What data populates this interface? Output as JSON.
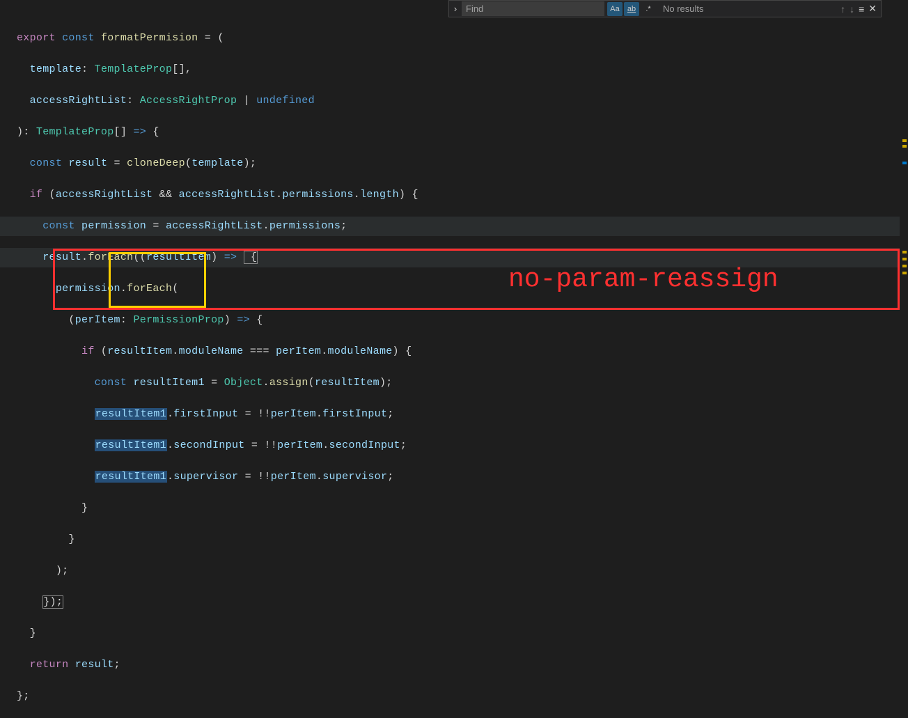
{
  "find": {
    "placeholder": "Find",
    "results": "No results",
    "toggles": {
      "aa": "Aa",
      "ab": "ab",
      "regex": ".*"
    }
  },
  "annotation": "no-param-reassign",
  "code": {
    "l1": {
      "a": "export",
      "b": "const",
      "c": "formatPermision",
      "d": " = ("
    },
    "l2": {
      "a": "template",
      "b": ": ",
      "c": "TemplateProp",
      "d": "[],"
    },
    "l3": {
      "a": "accessRightList",
      "b": ": ",
      "c": "AccessRightProp",
      "d": " | ",
      "e": "undefined"
    },
    "l4": {
      "a": "): ",
      "b": "TemplateProp",
      "c": "[] ",
      "d": "=>",
      "e": " {"
    },
    "l5": {
      "a": "const",
      "b": "result",
      "c": " = ",
      "d": "cloneDeep",
      "e": "(",
      "f": "template",
      "g": ");"
    },
    "l6": {
      "a": "if",
      "b": " (",
      "c": "accessRightList",
      "d": " && ",
      "e": "accessRightList",
      "f": ".",
      "g": "permissions",
      "h": ".",
      "i": "length",
      "j": ") {"
    },
    "l7": {
      "a": "const",
      "b": "permission",
      "c": " = ",
      "d": "accessRightList",
      "e": ".",
      "f": "permissions",
      "g": ";"
    },
    "l8": {
      "a": "result",
      "b": ".",
      "c": "forEach",
      "d": "((",
      "e": "resultItem",
      "f": ") ",
      "g": "=>",
      "h": " {"
    },
    "l9": {
      "a": "permission",
      "b": ".",
      "c": "forEach",
      "d": "("
    },
    "l10": {
      "a": "(",
      "b": "perItem",
      "c": ": ",
      "d": "PermissionProp",
      "e": ") ",
      "f": "=>",
      "g": " {"
    },
    "l11": {
      "a": "if",
      "b": " (",
      "c": "resultItem",
      "d": ".",
      "e": "moduleName",
      "f": " === ",
      "g": "perItem",
      "h": ".",
      "i": "moduleName",
      "j": ") {"
    },
    "l12": {
      "a": "const",
      "b": "resultItem1",
      "c": " = ",
      "d": "Object",
      "e": ".",
      "f": "assign",
      "g": "(",
      "h": "resultItem",
      "i": ");"
    },
    "l13": {
      "a": "resultItem1",
      "b": ".",
      "c": "firstInput",
      "d": " = !!",
      "e": "perItem",
      "f": ".",
      "g": "firstInput",
      "h": ";"
    },
    "l14": {
      "a": "resultItem1",
      "b": ".",
      "c": "secondInput",
      "d": " = !!",
      "e": "perItem",
      "f": ".",
      "g": "secondInput",
      "h": ";"
    },
    "l15": {
      "a": "resultItem1",
      "b": ".",
      "c": "supervisor",
      "d": " = !!",
      "e": "perItem",
      "f": ".",
      "g": "supervisor",
      "h": ";"
    },
    "l16": "}",
    "l17": "}",
    "l18": ");",
    "l19": "});",
    "l20": "}",
    "l21": {
      "a": "return",
      "b": "result",
      "c": ";"
    },
    "l22": "};"
  }
}
